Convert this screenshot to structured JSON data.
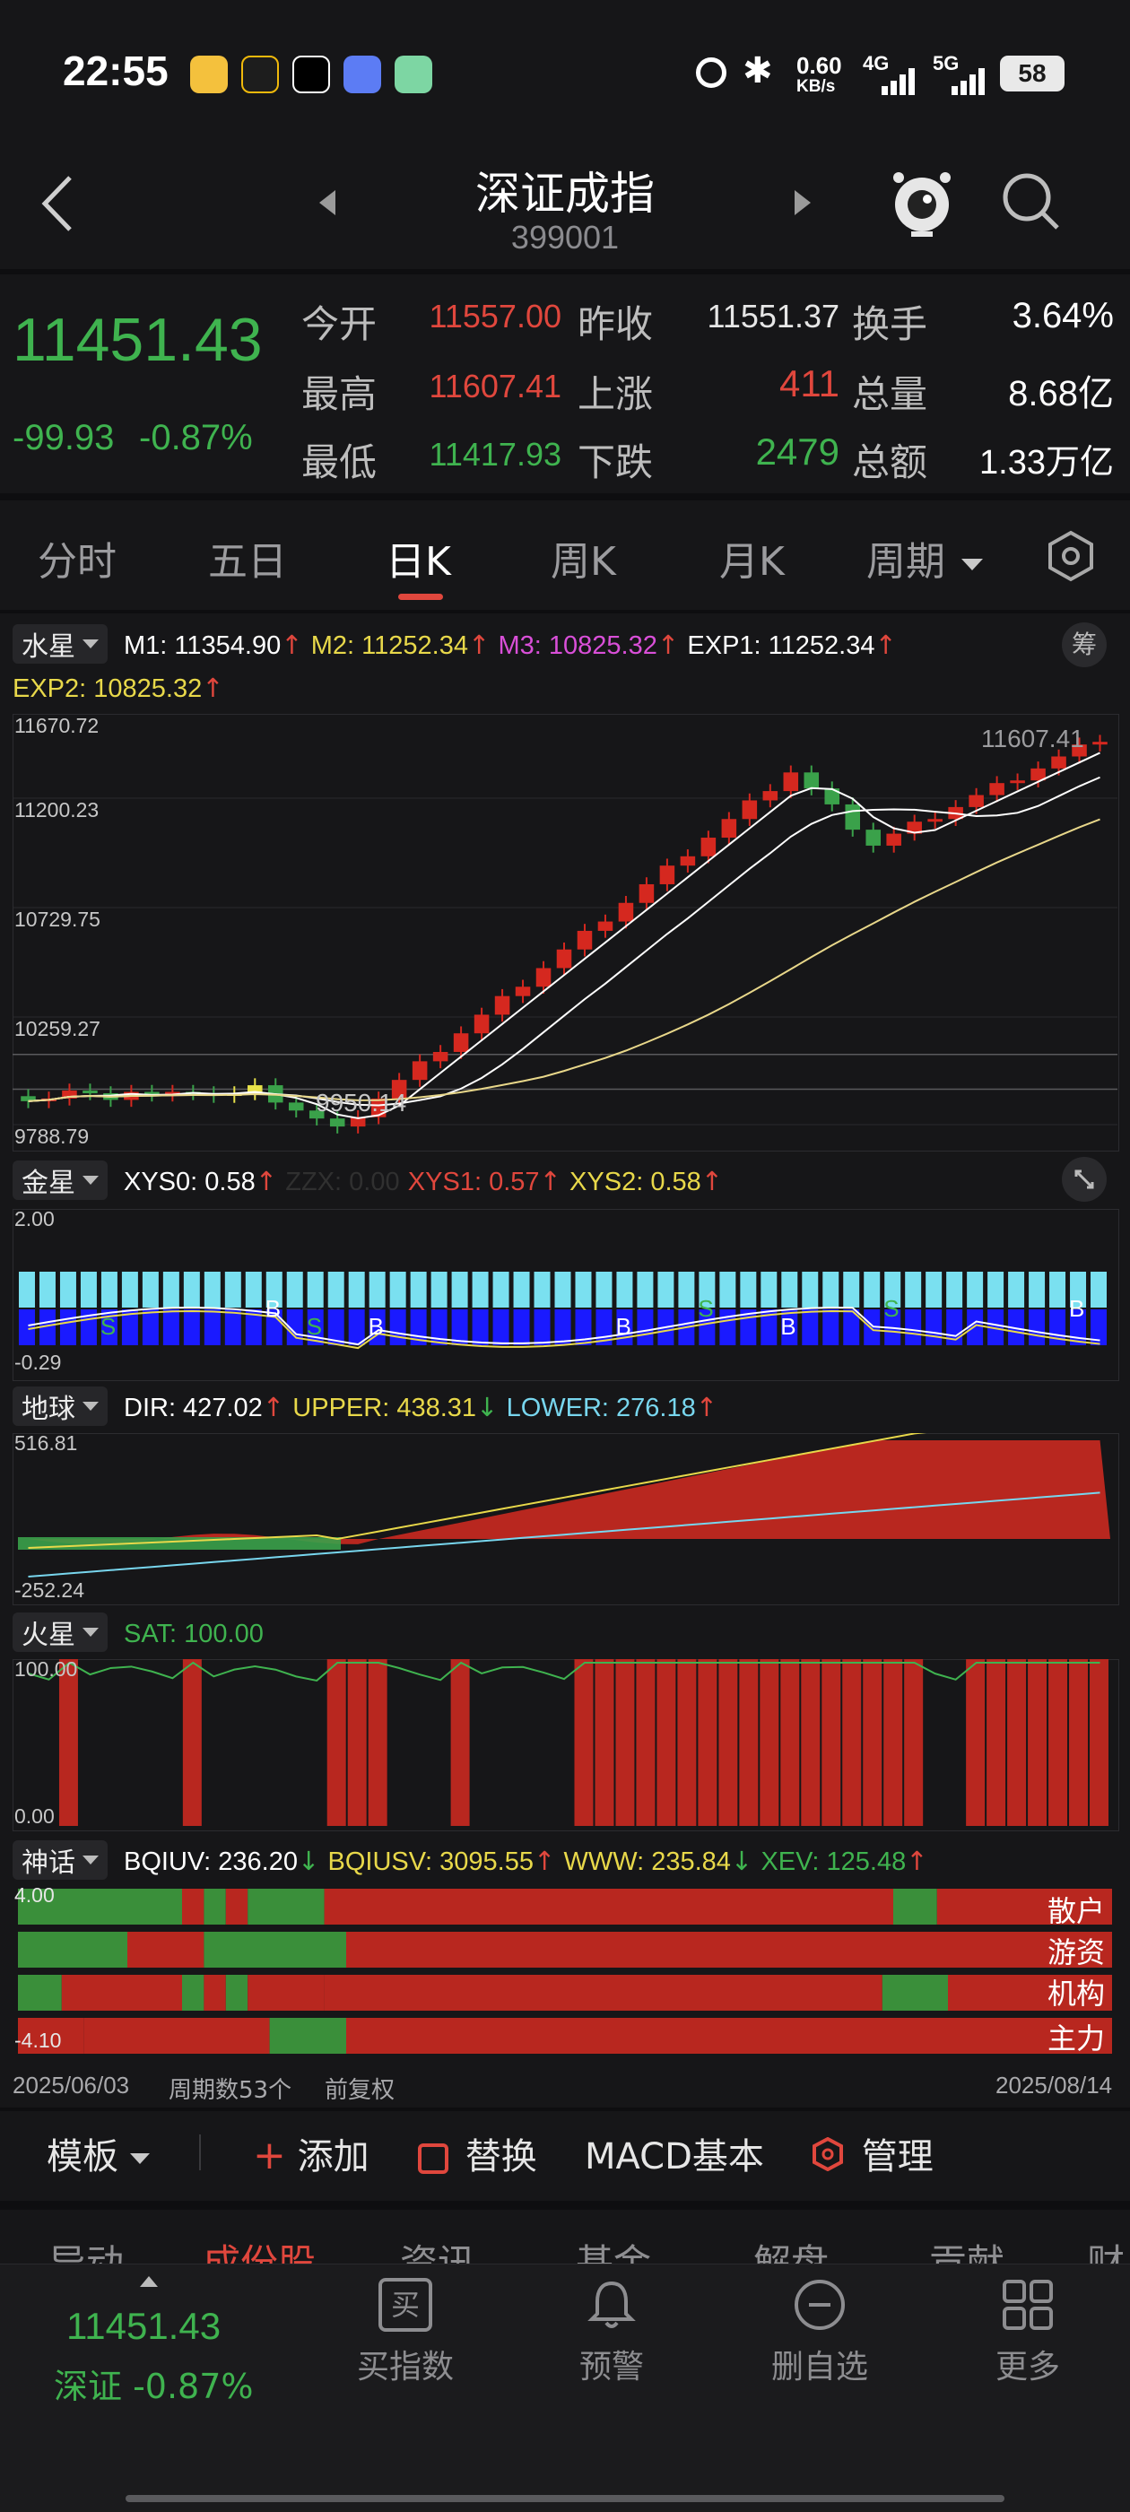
{
  "status_bar": {
    "time": "22:55",
    "net_speed": "0.60",
    "net_unit": "KB/s",
    "sig1": "4G",
    "sig2": "5G",
    "battery": "58"
  },
  "header": {
    "title": "深证成指",
    "code": "399001"
  },
  "quote": {
    "price": "11451.43",
    "change": "-99.93",
    "change_pct": "-0.87%",
    "open_label": "今开",
    "open": "11557.00",
    "high_label": "最高",
    "high": "11607.41",
    "low_label": "最低",
    "low": "11417.93",
    "prev_label": "昨收",
    "prev": "11551.37",
    "up_label": "上涨",
    "up": "411",
    "down_label": "下跌",
    "down": "2479",
    "turnover_label": "换手",
    "turnover": "3.64%",
    "vol_label": "总量",
    "vol": "8.68亿",
    "amount_label": "总额",
    "amount": "1.33万亿"
  },
  "tabs": [
    "分时",
    "五日",
    "日K",
    "周K",
    "月K",
    "周期"
  ],
  "main_chart": {
    "label": "水星",
    "chip_btn": "筹",
    "m1": "M1: 11354.90",
    "m2": "M2: 11252.34",
    "m3": "M3: 10825.32",
    "exp1": "EXP1: 11252.34",
    "exp2": "EXP2: 10825.32",
    "y_labels": [
      "11670.72",
      "11200.23",
      "10729.75",
      "10259.27",
      "9788.79"
    ],
    "hi_mark": "11607.41",
    "lo_mark": "9950.14"
  },
  "jin": {
    "label": "金星",
    "xys0": "XYS0: 0.58",
    "zzx": "ZZX: 0.00",
    "xys1": "XYS1: 0.57",
    "xys2": "XYS2: 0.58",
    "y_top": "2.00",
    "y_bot": "-0.29"
  },
  "di": {
    "label": "地球",
    "dir": "DIR: 427.02",
    "upper": "UPPER: 438.31",
    "lower": "LOWER: 276.18",
    "y_top": "516.81",
    "y_bot": "-252.24"
  },
  "huo": {
    "label": "火星",
    "sat": "SAT: 100.00",
    "y_top": "100.00",
    "y_bot": "0.00"
  },
  "shen": {
    "label": "神话",
    "bqiuv": "BQIUV: 236.20",
    "bqiusv": "BQIUSV: 3095.55",
    "www": "WWW: 235.84",
    "xev": "XEV: 125.48",
    "y_top": "4.00",
    "y_bot": "-4.10",
    "rows": [
      "散户",
      "游资",
      "机构",
      "主力"
    ]
  },
  "footer_info": {
    "start": "2025/06/03",
    "count": "周期数53个",
    "adj": "前复权",
    "end": "2025/08/14"
  },
  "toolbar": {
    "template": "模板",
    "add": "添加",
    "replace": "替换",
    "macd": "MACD基本",
    "manage": "管理"
  },
  "bottom_tabs": [
    "异动",
    "成份股",
    "资讯",
    "基金",
    "解盘",
    "贡献",
    "财"
  ],
  "bottom_nav": {
    "price": "11451.43",
    "sub": "深证 -0.87%",
    "buy": "买指数",
    "buy_glyph": "买",
    "alert": "预警",
    "remove": "删自选",
    "more": "更多"
  },
  "colors": {
    "up": "#d5281f",
    "down": "#3aa14a",
    "yellow": "#e8e24a",
    "bg": "#161618"
  }
}
